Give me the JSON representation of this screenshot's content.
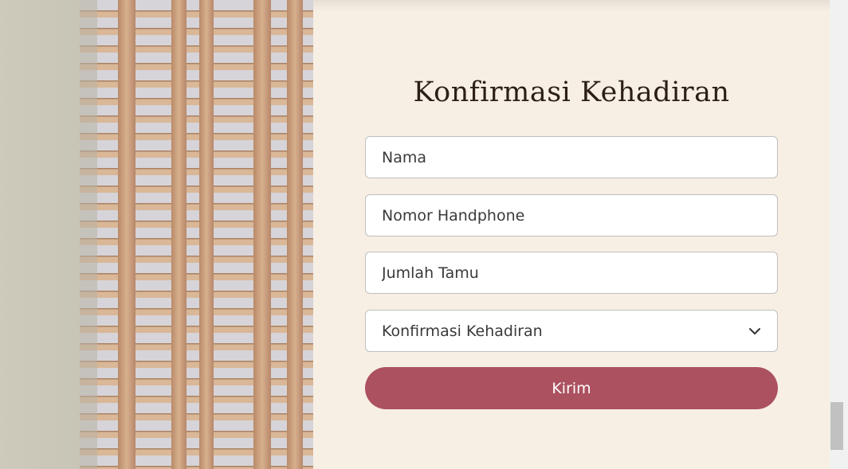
{
  "rsvp": {
    "title": "Konfirmasi Kehadiran",
    "name_placeholder": "Nama",
    "phone_placeholder": "Nomor Handphone",
    "guests_placeholder": "Jumlah Tamu",
    "attendance_selected": "Konfirmasi Kehadiran",
    "submit_label": "Kirim"
  },
  "icons": {
    "dropdown": "chevron-down-icon"
  },
  "colors": {
    "panel_background": "#f8efe4",
    "button_color": "#ab5160",
    "title_color": "#2b1f17"
  }
}
